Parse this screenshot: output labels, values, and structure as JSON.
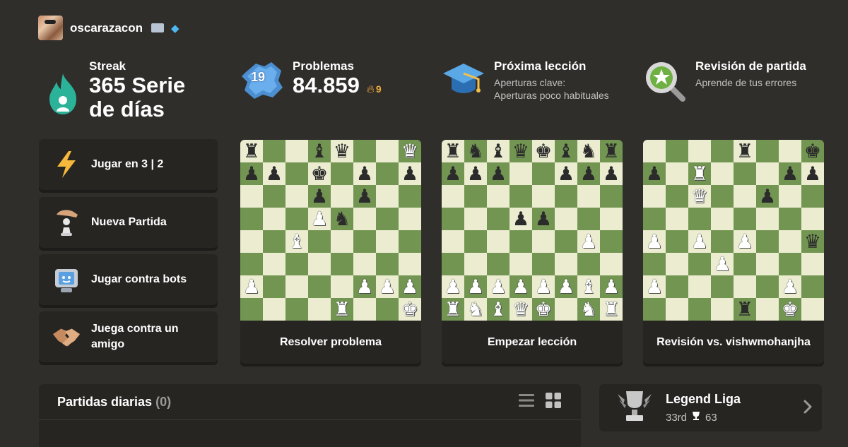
{
  "user": {
    "username": "oscarazacon",
    "flag_icon": "flag-icon",
    "badge_icon": "diamond-icon"
  },
  "stats": {
    "streak": {
      "title": "Streak",
      "value_line1": "365 Serie",
      "value_line2": "de días",
      "icon": "flame-icon"
    },
    "puzzles": {
      "title": "Problemas",
      "value": "84.859",
      "badge_number": "19",
      "flame_count": "9",
      "icon": "puzzle-icon"
    },
    "lesson": {
      "title": "Próxima lección",
      "sub_line1": "Aperturas clave:",
      "sub_line2": "Aperturas poco habituales",
      "icon": "graduation-cap-icon"
    },
    "review": {
      "title": "Revisión de partida",
      "sub": "Aprende de tus errores",
      "icon": "magnifier-star-icon"
    }
  },
  "side_buttons": [
    {
      "label": "Jugar en 3 | 2",
      "icon": "lightning-icon"
    },
    {
      "label": "Nueva Partida",
      "icon": "hand-pawn-icon"
    },
    {
      "label": "Jugar contra bots",
      "icon": "robot-icon"
    },
    {
      "label": "Juega contra un amigo",
      "icon": "handshake-icon"
    }
  ],
  "cards": [
    {
      "label": "Resolver problema",
      "board": [
        "r..bq..Q",
        "pp.k.p.p",
        "...p.p..",
        "...Pn...",
        "..B.....",
        "........",
        "P....PPP",
        "....R..K"
      ]
    },
    {
      "label": "Empezar lección",
      "board": [
        "rnbqkbnr",
        "ppp..ppp",
        "........",
        "...pp...",
        "......P.",
        "........",
        "PPPPPPBP",
        "RNBQK.NR"
      ]
    },
    {
      "label": "Revisión vs. vishwmohanjha",
      "board": [
        "....r..k",
        "p.R...pp",
        "..Q..p..",
        "........",
        "P.P.P..q",
        "...P....",
        "P.....P.",
        "....r.K."
      ]
    }
  ],
  "daily": {
    "title": "Partidas diarias",
    "count": "(0)",
    "list_icon": "list-view-icon",
    "grid_icon": "grid-view-icon"
  },
  "league": {
    "name": "Legend Liga",
    "rank": "33rd",
    "trophies": "63",
    "icon": "trophy-icon"
  }
}
